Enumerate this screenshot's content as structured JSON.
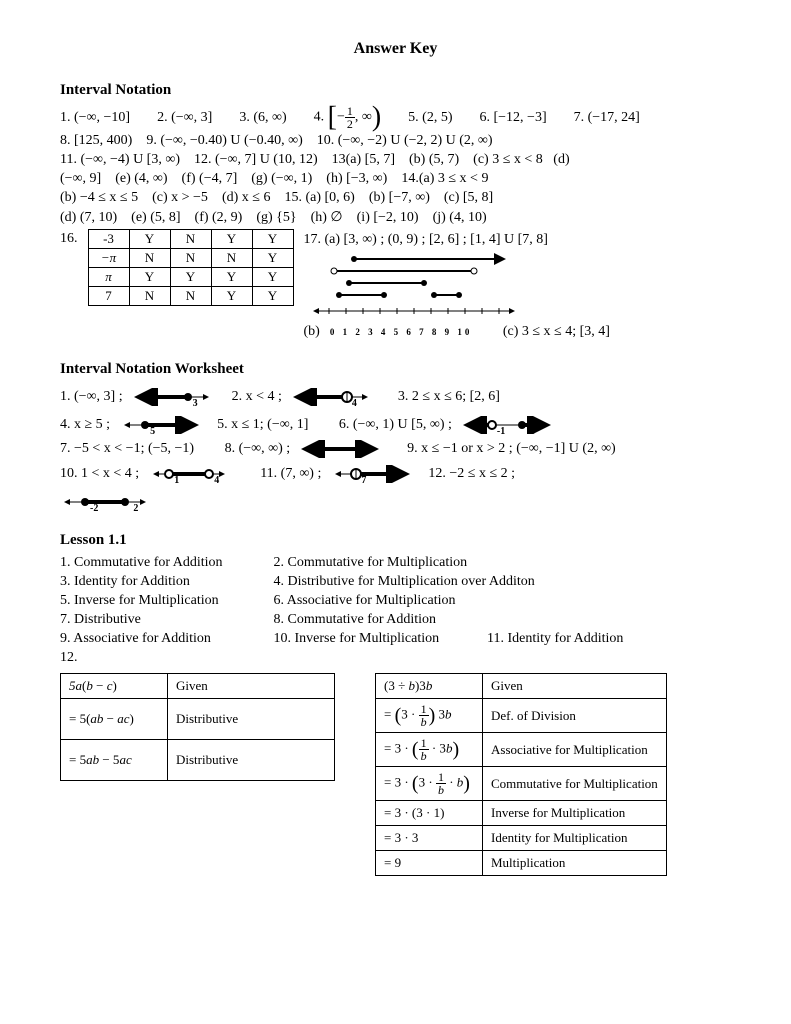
{
  "title": "Answer Key",
  "sec1": {
    "heading": "Interval Notation",
    "p1": "1.  (−∞, −10]",
    "p2": "2.  (−∞, 3]",
    "p3": "3.  (6, ∞)",
    "p4_pre": "4.  ",
    "p4_frac_num": "1",
    "p4_frac_den": "2",
    "p5": "5.  (2, 5)",
    "p6": "6.  [−12, −3]",
    "p7": "7.  (−17, 24]",
    "p8": "8.  [125, 400)",
    "p9": "9.  (−∞, −0.40) U (−0.40, ∞)",
    "p10": "10.  (−∞, −2) U (−2, 2) U (2, ∞)",
    "p11": "11.  (−∞, −4) U [3, ∞)",
    "p12": "12.  (−∞, 7] U (10, 12)",
    "p13a": "13(a) [5, 7]",
    "p13b": "(b) (5, 7)",
    "p13c": "(c) 3 ≤ x < 8",
    "p13d": "(d)",
    "p13d2": "(−∞, 9]",
    "p13e": "(e) (4, ∞)",
    "p13f": "(f) (−4, 7]",
    "p13g": "(g) (−∞, 1)",
    "p13h": "(h) [−3, ∞)",
    "p14a": "14.(a) 3 ≤ x < 9",
    "p14b": "(b) −4 ≤ x ≤ 5",
    "p14c": "(c) x > −5",
    "p14d": "(d) x ≤ 6",
    "p15a": "15. (a) [0, 6)",
    "p15b": "(b) [−7, ∞)",
    "p15c": "(c) [5, 8]",
    "p15d": "(d) (7, 10)",
    "p15e": "(e) (5, 8]",
    "p15f": "(f) (2, 9)",
    "p15g": "(g) {5}",
    "p15h": "(h) ∅",
    "p15i": "(i) [−2, 10)",
    "p15j": "(j) (4, 10)",
    "p16": "16.",
    "yn_rows": [
      [
        "-3",
        "Y",
        "N",
        "Y",
        "Y"
      ],
      [
        "−π",
        "N",
        "N",
        "N",
        "Y"
      ],
      [
        "π",
        "Y",
        "Y",
        "Y",
        "Y"
      ],
      [
        "7",
        "N",
        "N",
        "Y",
        "Y"
      ]
    ],
    "p17": "17.  (a) [3, ∞) ;  (0, 9) ;  [2, 6] ;  [1, 4] U [7, 8]",
    "p17b": "(b)",
    "p17c": "(c) 3 ≤ x ≤ 4; [3, 4]"
  },
  "sec2": {
    "heading": "Interval Notation Worksheet",
    "p1": "1.  (−∞, 3] ;",
    "p2": "2.   x < 4 ;",
    "p3": "3.  2 ≤ x ≤ 6;  [2, 6]",
    "p4": "4.   x ≥ 5 ;",
    "p5": "5.  x ≤ 1;  (−∞, 1]",
    "p6": "6.  (−∞, 1) U [5, ∞) ;",
    "p7": "7.  −5 < x < −1;  (−5, −1)",
    "p8": "8.  (−∞, ∞) ;",
    "p9": "9.   x ≤ −1 or  x > 2 ; (−∞, −1] U (2, ∞)",
    "p10": "10.  1 < x < 4 ;",
    "p11": "11.  (7, ∞) ;",
    "p12": "12.  −2 ≤ x ≤ 2 ;",
    "lbl_3": "3",
    "lbl_4": "4",
    "lbl_5": "5",
    "lbl_n1": "-1",
    "lbl_1": "1",
    "lbl_7": "7",
    "lbl_n2": "-2",
    "lbl_2": "2"
  },
  "sec3": {
    "heading": "Lesson 1.1",
    "p1": "1.  Commutative for Addition",
    "p2": "2.  Commutative for Multiplication",
    "p3": "3.  Identity for Addition",
    "p4": "4.  Distributive for Multiplication over Additon",
    "p5": "5.  Inverse for Multiplication",
    "p6": "6.  Associative for Multiplication",
    "p7": "7.  Distributive",
    "p8": "8.  Commutative for Addition",
    "p9": "9.  Associative for Addition",
    "p10": "10.  Inverse for Multiplication",
    "p11": "11.  Identity for Addition",
    "p12": "12.",
    "tableA": [
      [
        "5a(b − c)",
        "Given"
      ],
      [
        "= 5(ab − ac)",
        "Distributive"
      ],
      [
        "= 5ab − 5ac",
        "Distributive"
      ]
    ],
    "tableB": [
      [
        "(3 ÷ b)3b",
        "Given"
      ],
      [
        "= (3 · 1/b) 3b",
        "Def. of Division"
      ],
      [
        "= 3 · (1/b · 3b)",
        "Associative for Multiplication"
      ],
      [
        "= 3 · (3 · 1/b · b)",
        "Commutative for Multiplication"
      ],
      [
        "= 3 · (3 · 1)",
        "Inverse for Multiplication"
      ],
      [
        "= 3 · 3",
        "Identity for Multiplication"
      ],
      [
        "= 9",
        "Multiplication"
      ]
    ],
    "frac1b_num": "1",
    "frac1b_den": "b"
  }
}
